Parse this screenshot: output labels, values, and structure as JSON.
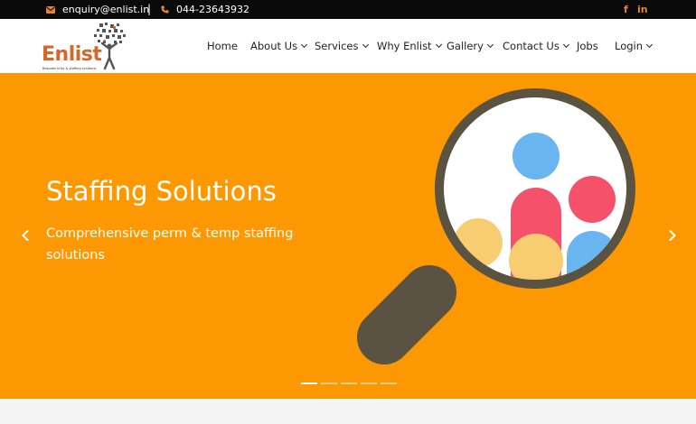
{
  "topbar": {
    "email": "enquiry@enlist.in",
    "separator": "|",
    "phone": "044-23643932",
    "social": {
      "facebook": "f",
      "linkedin": "in"
    },
    "icons": {
      "email": "envelope-icon",
      "phone": "phone-icon"
    }
  },
  "logo": {
    "name": "Enlist",
    "tagline": "Bespoke hr&e & staffing solutions"
  },
  "nav": {
    "items": [
      {
        "label": "Home",
        "dropdown": false
      },
      {
        "label": "About Us",
        "dropdown": true
      },
      {
        "label": "Services",
        "dropdown": true
      },
      {
        "label": "Why Enlist",
        "dropdown": true
      },
      {
        "label": "Gallery",
        "dropdown": true
      },
      {
        "label": "Contact Us",
        "dropdown": true
      },
      {
        "label": "Jobs",
        "dropdown": false
      },
      {
        "label": "Login",
        "dropdown": true
      }
    ]
  },
  "hero": {
    "title": "Staffing Solutions",
    "subtitle": "Comprehensive perm & temp staffing solutions",
    "slides": 5,
    "active_slide": 1
  },
  "colors": {
    "accent": "#e8842a",
    "hero_bg": "#fc9902",
    "logo_orange": "#d2692a",
    "magnifier": "#5a5341",
    "blue": "#69b5f0",
    "pink": "#f5516b",
    "yellow": "#f8cc70"
  }
}
